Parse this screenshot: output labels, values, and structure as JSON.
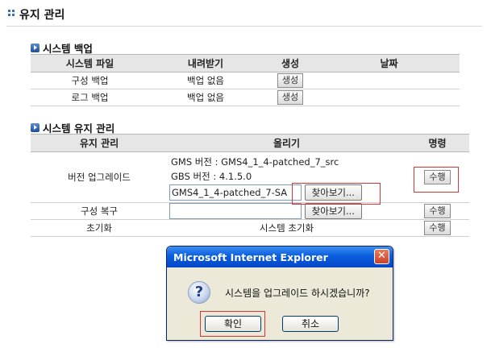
{
  "page": {
    "title": "유지 관리"
  },
  "backup": {
    "section_title": "시스템 백업",
    "headers": [
      "시스템 파일",
      "내려받기",
      "생성",
      "날짜"
    ],
    "rows": [
      {
        "name": "구성 백업",
        "download": "백업 없음",
        "action": "생성",
        "date": ""
      },
      {
        "name": "로그 백업",
        "download": "백업 없음",
        "action": "생성",
        "date": ""
      }
    ]
  },
  "maintenance": {
    "section_title": "시스템 유지 관리",
    "headers": [
      "유지 관리",
      "올리기",
      "명령"
    ],
    "upgrade": {
      "label": "버전 업그레이드",
      "gms_version": "GMS 버전 : GMS4_1_4-patched_7_src",
      "gbs_version": "GBS 버전 : 4.1.5.0",
      "file_value": "GMS4_1_4-patched_7-SA",
      "browse_label": "찾아보기...",
      "run_label": "수행"
    },
    "restore": {
      "label": "구성 복구",
      "file_value": "",
      "browse_label": "찾아보기...",
      "run_label": "수행"
    },
    "reset": {
      "label": "초기화",
      "text": "시스템 초기화",
      "run_label": "수행"
    }
  },
  "dialog": {
    "title": "Microsoft Internet Explorer",
    "message": "시스템을 업그레이드 하시겠습니까?",
    "ok_label": "확인",
    "cancel_label": "취소"
  },
  "colors": {
    "highlight": "#d83535",
    "title_bar": "#0a5ee0",
    "header_bg": "#e6e6e6"
  }
}
